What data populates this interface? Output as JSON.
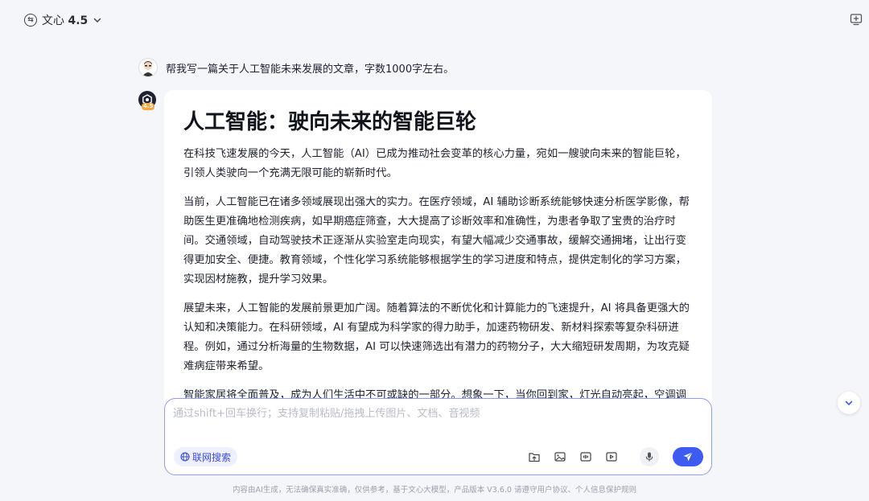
{
  "header": {
    "model_name": "文心",
    "model_version": "4.5",
    "model_icon": "model-switch-icon",
    "new_chat_icon": "new-chat-icon"
  },
  "conversation": {
    "user_message": "帮我写一篇关于人工智能未来发展的文章，字数1000字左右。",
    "bot_badge": "4.5",
    "answer": {
      "title": "人工智能：驶向未来的智能巨轮",
      "paragraphs": [
        "在科技飞速发展的今天，人工智能（AI）已成为推动社会变革的核心力量，宛如一艘驶向未来的智能巨轮，引领人类驶向一个充满无限可能的崭新时代。",
        "当前，人工智能已在诸多领域展现出强大的实力。在医疗领域，AI 辅助诊断系统能够快速分析医学影像，帮助医生更准确地检测疾病，如早期癌症筛查，大大提高了诊断效率和准确性，为患者争取了宝贵的治疗时间。交通领域，自动驾驶技术正逐渐从实验室走向现实，有望大幅减少交通事故，缓解交通拥堵，让出行变得更加安全、便捷。教育领域，个性化学习系统能够根据学生的学习进度和特点，提供定制化的学习方案，实现因材施教，提升学习效果。",
        "展望未来，人工智能的发展前景更加广阔。随着算法的不断优化和计算能力的飞速提升，AI 将具备更强大的认知和决策能力。在科研领域，AI 有望成为科学家的得力助手，加速药物研发、新材料探索等复杂科研进程。例如，通过分析海量的生物数据，AI 可以快速筛选出有潜力的药物分子，大大缩短研发周期，为攻克疑难病症带来希望。",
        "智能家居将全面普及，成为人们生活中不可或缺的一部分。想象一下，当你回到家，灯光自动亮起，空调调节到适宜温度，智能音箱播放着你喜欢的音乐，各种家电设备根据你的习惯和需求自动运行。AI 管家能够精准理解你"
      ]
    }
  },
  "input": {
    "placeholder": "通过shift+回车换行；支持复制粘贴/拖拽上传图片、文档、音视频",
    "web_search_label": "联网搜索"
  },
  "toolbar_icons": [
    "upload-file-icon",
    "image-icon",
    "audio-icon",
    "video-icon",
    "microphone-icon",
    "send-icon"
  ],
  "colors": {
    "accent": "#3d5af1",
    "input_border": "#8f9cf5",
    "web_search_bg": "#eef0ff",
    "background": "#f5f6fa"
  },
  "footer": {
    "disclaimer": "内容由AI生成，无法确保真实准确，仅供参考，基于文心大模型，产品版本 V3.6.0 请遵守用户协议、个人信息保护规则"
  }
}
